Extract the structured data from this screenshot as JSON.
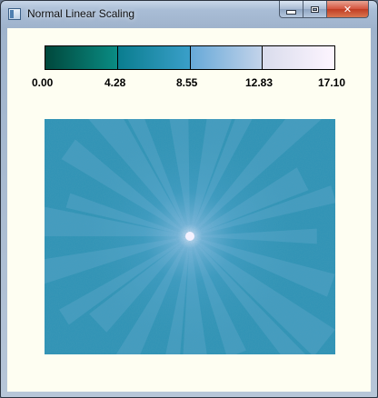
{
  "window": {
    "title": "Normal Linear Scaling"
  },
  "controls": {
    "close": "✕"
  },
  "colorbar": {
    "ticks": [
      "0.00",
      "4.28",
      "8.55",
      "12.83",
      "17.10"
    ],
    "segments": [
      {
        "from": "#00483c",
        "to": "#0a8c84"
      },
      {
        "from": "#0a7d8f",
        "to": "#3a9fc9"
      },
      {
        "from": "#67a9d8",
        "to": "#c3d3ea"
      },
      {
        "from": "#d9dcec",
        "to": "#fdf5ff"
      }
    ]
  },
  "image": {
    "colors": {
      "background": "#2f93b5",
      "mid": "#4aa3cc",
      "light": "#8fc0e4",
      "center": "#f4f1ff"
    }
  }
}
